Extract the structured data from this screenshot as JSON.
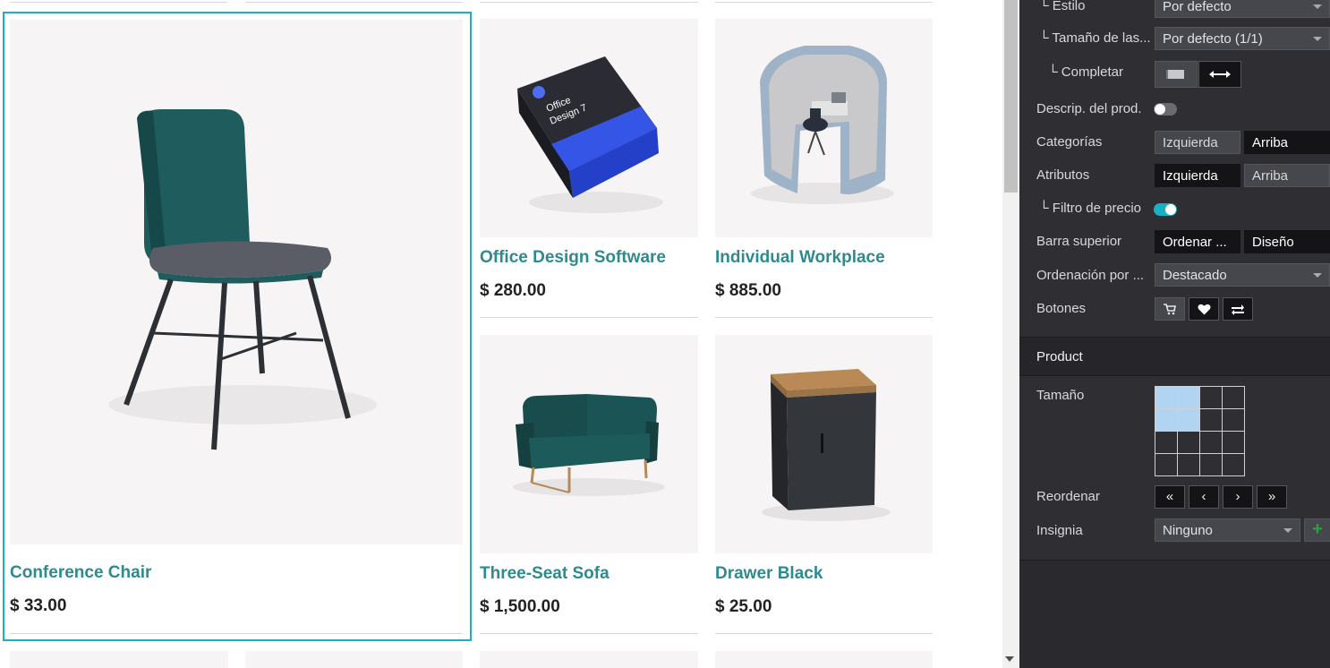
{
  "products": [
    {
      "name": "Conference Chair",
      "price": "$ 33.00"
    },
    {
      "name": "Office Design Software",
      "price": "$ 280.00"
    },
    {
      "name": "Individual Workplace",
      "price": "$ 885.00"
    },
    {
      "name": "Three-Seat Sofa",
      "price": "$ 1,500.00"
    },
    {
      "name": "Drawer Black",
      "price": "$ 25.00"
    }
  ],
  "software_box": {
    "line1": "Office",
    "line2": "Design 7"
  },
  "options": {
    "estilo": {
      "label": "└ Estilo",
      "value": "Por defecto"
    },
    "tamano": {
      "label": "└ Tamaño de las...",
      "value": "Por defecto (1/1)"
    },
    "completar": {
      "label": "└ Completar"
    },
    "descrip": {
      "label": "Descrip. del prod."
    },
    "categorias": {
      "label": "Categorías",
      "opt1": "Izquierda",
      "opt2": "Arriba"
    },
    "atributos": {
      "label": "Atributos",
      "opt1": "Izquierda",
      "opt2": "Arriba"
    },
    "filtro": {
      "label": "└ Filtro de precio"
    },
    "barra": {
      "label": "Barra superior",
      "opt1": "Ordenar ...",
      "opt2": "Diseño"
    },
    "ordenacion": {
      "label": "Ordenación por ...",
      "value": "Destacado"
    },
    "botones": {
      "label": "Botones"
    }
  },
  "product_section": {
    "title": "Product",
    "tamano_label": "Tamaño",
    "reordenar_label": "Reordenar",
    "insignia_label": "Insignia",
    "insignia_value": "Ninguno",
    "nav": [
      "«",
      "‹",
      "›",
      "»"
    ],
    "plus": "+"
  },
  "icons": {
    "cart": "cart-icon",
    "heart": "heart-icon",
    "compare": "compare-icon"
  },
  "colors": {
    "accent": "#19b0c4",
    "product_name": "#2f8a8e",
    "panel_bg": "#2e2e33"
  }
}
